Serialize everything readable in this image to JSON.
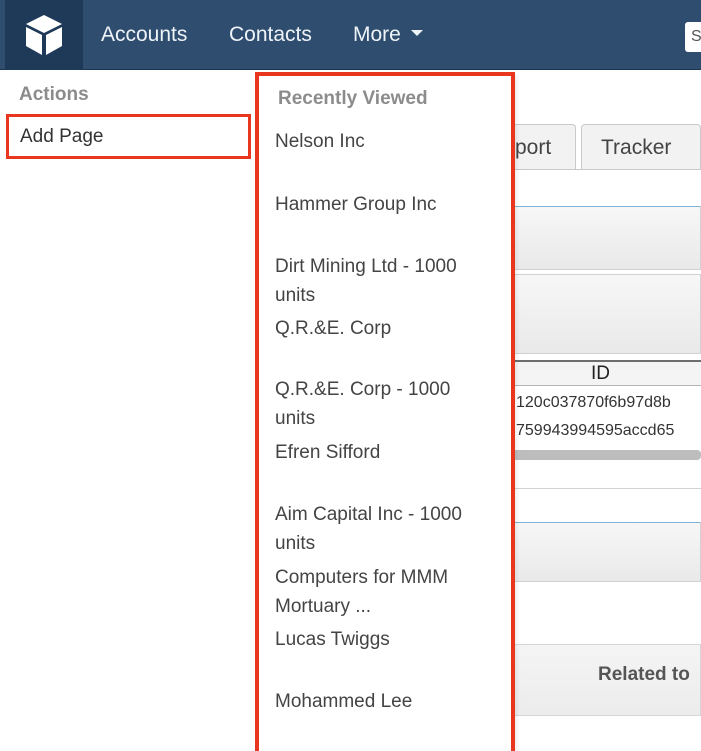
{
  "nav": {
    "items": [
      {
        "label": "Accounts"
      },
      {
        "label": "Contacts"
      },
      {
        "label": "More"
      }
    ],
    "search_placeholder": "S"
  },
  "actions": {
    "header": "Actions",
    "items": [
      {
        "label": "Add Page"
      }
    ]
  },
  "recently_viewed": {
    "header": "Recently Viewed",
    "items": [
      {
        "label": "Nelson Inc"
      },
      {
        "label": "Hammer Group Inc"
      },
      {
        "label": "Dirt Mining Ltd - 1000 units"
      },
      {
        "label": "Q.R.&E. Corp"
      },
      {
        "label": "Q.R.&E. Corp - 1000 units"
      },
      {
        "label": "Efren Sifford"
      },
      {
        "label": "Aim Capital Inc - 1000 units"
      },
      {
        "label": "Computers for MMM Mortuary ..."
      },
      {
        "label": "Lucas Twiggs"
      },
      {
        "label": "Mohammed Lee"
      }
    ]
  },
  "background": {
    "tabs": [
      {
        "label": "port"
      },
      {
        "label": "Tracker"
      }
    ],
    "table": {
      "header": "ID",
      "rows": [
        "120c037870f6b97d8b",
        "759943994595accd65"
      ]
    },
    "related_label": "Related to"
  },
  "colors": {
    "nav_bg": "#2f4d6e",
    "highlight": "#e8361f"
  }
}
